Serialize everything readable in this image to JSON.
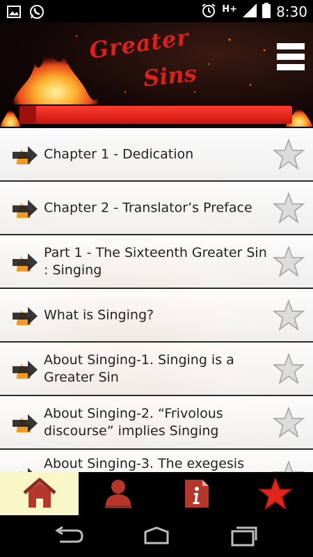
{
  "status_bar": {
    "time": "8:30",
    "network": "H+",
    "icons": [
      "image-icon",
      "whatsapp-icon",
      "alarm-icon",
      "signal-icon",
      "battery-icon"
    ]
  },
  "header": {
    "title_line1": "Greater",
    "title_line2": "Sins",
    "menu_icon": "hamburger-menu-icon",
    "title_color": "#d9201b",
    "bar_color": "#e3241d"
  },
  "chapters": [
    {
      "label": "Chapter 1 - Dedication"
    },
    {
      "label": "Chapter 2 - Translator’s Preface"
    },
    {
      "label": "Part 1 - The Sixteenth Greater Sin : Singing"
    },
    {
      "label": "What is Singing?"
    },
    {
      "label": "About Singing-1. Singing is a Greater Sin"
    },
    {
      "label": "About Singing-2. “Frivolous discourse” implies Singing"
    },
    {
      "label": "About Singing-3. The exegesis"
    }
  ],
  "bottom_nav": {
    "items": [
      "home-icon",
      "profile-icon",
      "info-icon",
      "favorites-star-icon"
    ],
    "active": "home-icon",
    "accent": "#b5362b"
  },
  "system_nav": [
    "back-icon",
    "home-button-icon",
    "recent-apps-icon"
  ]
}
